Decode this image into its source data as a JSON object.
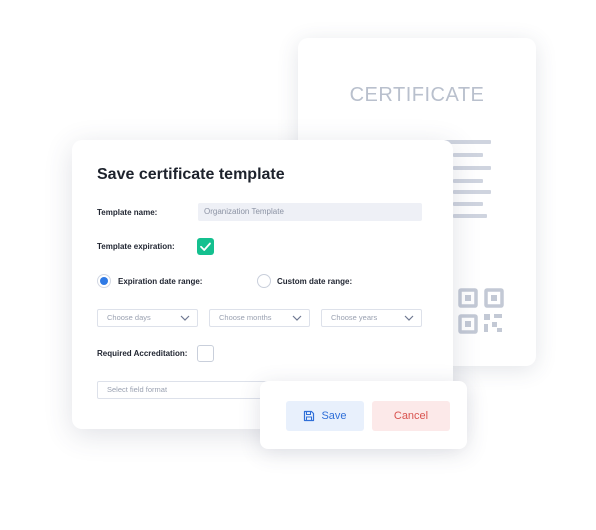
{
  "certificate": {
    "title": "CERTIFICATE"
  },
  "dialog": {
    "title": "Save certificate template",
    "template_name": {
      "label": "Template name:",
      "value": "Organization Template"
    },
    "template_expiration": {
      "label": "Template expiration:",
      "checked": true
    },
    "expiration_range": {
      "label": "Expiration date range:",
      "selected": true
    },
    "custom_range": {
      "label": "Custom date range:",
      "selected": false
    },
    "selects": {
      "days": "Choose days",
      "months": "Choose months",
      "years": "Choose years"
    },
    "required_accreditation": {
      "label": "Required Accreditation:",
      "checked": false
    },
    "field_format": {
      "placeholder": "Select field format"
    }
  },
  "actions": {
    "save_label": "Save",
    "cancel_label": "Cancel"
  },
  "colors": {
    "accent_green": "#14c08f",
    "accent_blue": "#2f7ae5",
    "save_text": "#2f6fd8",
    "cancel_text": "#d9534f"
  }
}
